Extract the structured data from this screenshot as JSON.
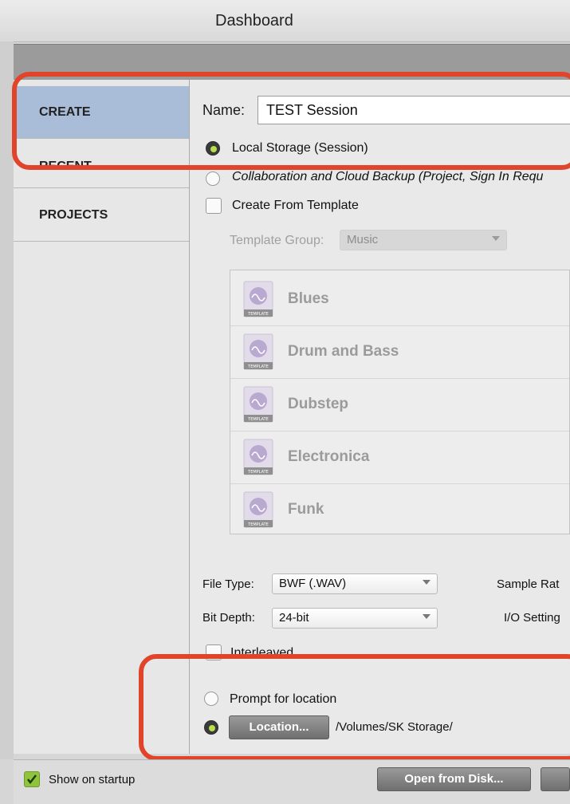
{
  "window": {
    "title": "Dashboard"
  },
  "sidebar": {
    "items": [
      {
        "label": "CREATE",
        "active": true
      },
      {
        "label": "RECENT",
        "active": false
      },
      {
        "label": "PROJECTS",
        "active": false
      }
    ]
  },
  "create": {
    "name_label": "Name:",
    "name_value": "TEST Session",
    "storage_local": "Local Storage (Session)",
    "storage_cloud": "Collaboration and Cloud Backup (Project, Sign In Requ",
    "create_from_template": "Create From Template",
    "template_group_label": "Template Group:",
    "template_group_value": "Music",
    "template_icon_caption": "TEMPLATE",
    "templates": [
      "Blues",
      "Drum and Bass",
      "Dubstep",
      "Electronica",
      "Funk"
    ],
    "file_type_label": "File Type:",
    "file_type_value": "BWF (.WAV)",
    "sample_rate_label": "Sample Rat",
    "bit_depth_label": "Bit Depth:",
    "bit_depth_value": "24-bit",
    "io_settings_label": "I/O Setting",
    "interleaved_label": "Interleaved",
    "prompt_location": "Prompt for location",
    "location_button": "Location...",
    "location_path": "/Volumes/SK Storage/"
  },
  "footer": {
    "show_on_startup": "Show on startup",
    "show_on_startup_checked": true,
    "open_from_disk": "Open from Disk..."
  },
  "colors": {
    "highlight_red": "#e0452b",
    "sidebar_active": "#a9bdd9",
    "radio_on": "#b7e04c"
  }
}
